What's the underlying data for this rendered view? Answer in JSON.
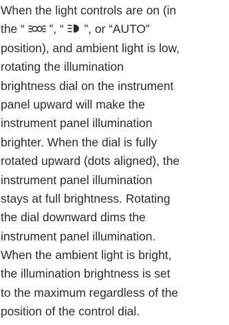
{
  "paragraph": {
    "lines": [
      "When the light controls are on (in",
      {
        "before": "the “ ",
        "icon1": "parking-lamp-icon",
        "mid1": " ”, “ ",
        "icon2": "headlamp-icon",
        "after": " ”, or “AUTO”"
      },
      "position), and ambient light is low,",
      "rotating the illumination",
      "brightness dial on the instrument",
      "panel upward will make the",
      "instrument panel illumination",
      "brighter. When the dial is fully",
      "rotated upward (dots aligned), the",
      "instrument panel illumination",
      "stays at full brightness. Rotating",
      "the dial downward dims the",
      "instrument panel illumination.",
      "When the ambient light is bright,",
      "the illumination brightness is set",
      "to the maximum regardless of the",
      "position of the control dial."
    ]
  }
}
